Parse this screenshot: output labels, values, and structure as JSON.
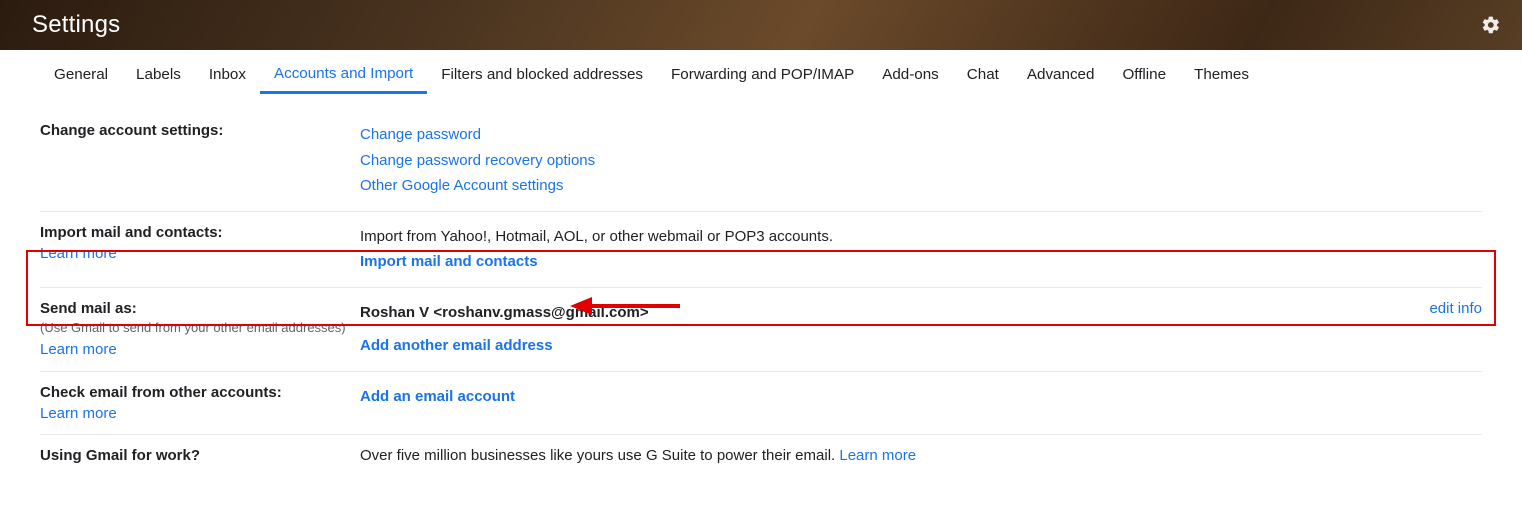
{
  "header": {
    "title": "Settings"
  },
  "tabs": {
    "items": [
      {
        "label": "General"
      },
      {
        "label": "Labels"
      },
      {
        "label": "Inbox"
      },
      {
        "label": "Accounts and Import"
      },
      {
        "label": "Filters and blocked addresses"
      },
      {
        "label": "Forwarding and POP/IMAP"
      },
      {
        "label": "Add-ons"
      },
      {
        "label": "Chat"
      },
      {
        "label": "Advanced"
      },
      {
        "label": "Offline"
      },
      {
        "label": "Themes"
      }
    ],
    "activeIndex": 3
  },
  "sections": {
    "changeAccount": {
      "title": "Change account settings:",
      "links": {
        "changePassword": "Change password",
        "changeRecovery": "Change password recovery options",
        "otherSettings": "Other Google Account settings"
      }
    },
    "importMail": {
      "title": "Import mail and contacts:",
      "learnMore": "Learn more",
      "desc": "Import from Yahoo!, Hotmail, AOL, or other webmail or POP3 accounts.",
      "action": "Import mail and contacts"
    },
    "sendMailAs": {
      "title": "Send mail as:",
      "sub": "(Use Gmail to send from your other email addresses)",
      "learnMore": "Learn more",
      "identity": "Roshan V <roshanv.gmass@gmail.com>",
      "addAnother": "Add another email address",
      "editInfo": "edit info"
    },
    "checkEmail": {
      "title": "Check email from other accounts:",
      "learnMore": "Learn more",
      "action": "Add an email account"
    },
    "gmailWork": {
      "title": "Using Gmail for work?",
      "desc": "Over five million businesses like yours use G Suite to power their email. ",
      "learnMore": "Learn more"
    }
  }
}
